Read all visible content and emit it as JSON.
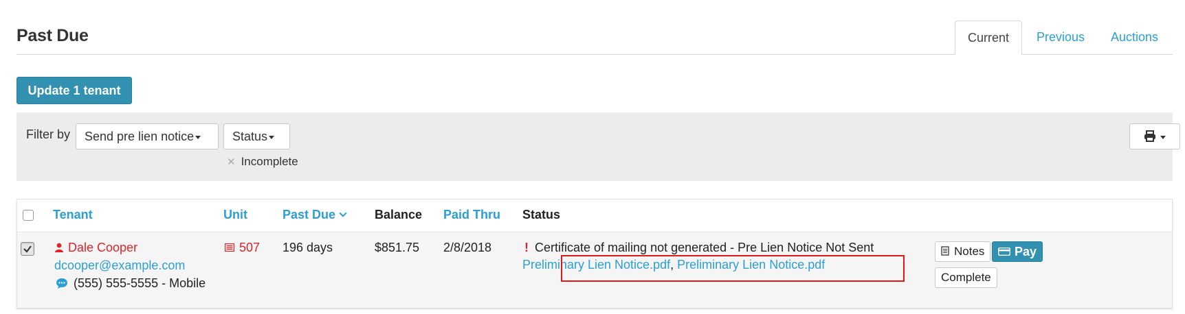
{
  "page": {
    "title": "Past Due"
  },
  "tabs": [
    {
      "label": "Current",
      "active": true
    },
    {
      "label": "Previous",
      "active": false
    },
    {
      "label": "Auctions",
      "active": false
    }
  ],
  "toolbar": {
    "update_label": "Update 1 tenant"
  },
  "filters": {
    "label": "Filter by",
    "send_dropdown": "Send pre lien notice",
    "status_dropdown": "Status",
    "active_chip": "Incomplete",
    "print_icon": "printer-icon"
  },
  "table": {
    "headers": {
      "tenant": "Tenant",
      "unit": "Unit",
      "past_due": "Past Due",
      "balance": "Balance",
      "paid_thru": "Paid Thru",
      "status": "Status"
    },
    "rows": [
      {
        "checked": true,
        "tenant_name": "Dale Cooper",
        "email": "dcooper@example.com",
        "phone": "(555) 555-5555 - Mobile",
        "unit": "507",
        "past_due": "196 days",
        "balance": "$851.75",
        "paid_thru": "2/8/2018",
        "status_text": "Certificate of mailing not generated - Pre Lien Notice Not Sent",
        "files": [
          "Preliminary Lien Notice.pdf",
          "Preliminary Lien Notice.pdf"
        ],
        "file_separator": ",",
        "actions": {
          "notes": "Notes",
          "pay": "Pay",
          "complete": "Complete"
        }
      }
    ]
  },
  "colors": {
    "link": "#2a9fd6",
    "primary_button": "#3291b0",
    "alert_red": "#e0242a",
    "annotation_box": "#e01818"
  }
}
